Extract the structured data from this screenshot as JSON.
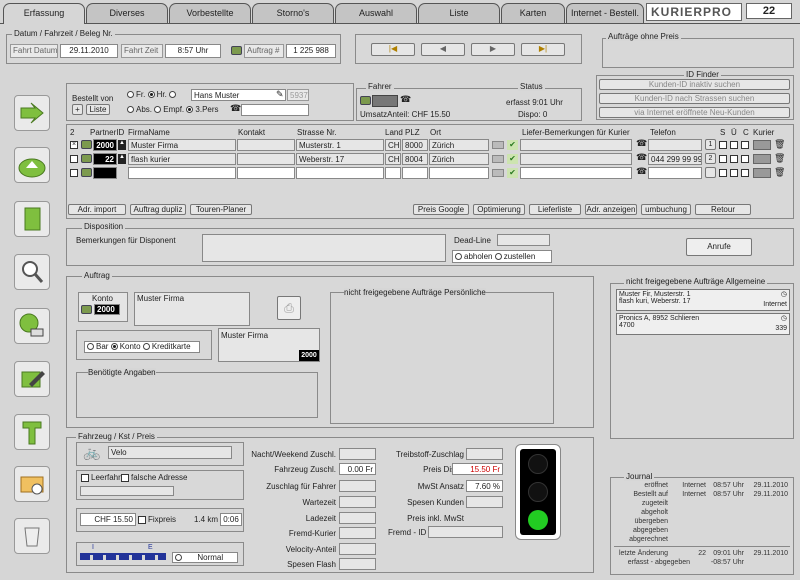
{
  "tabs": [
    "Erfassung",
    "Diverses",
    "Vorbestellte",
    "Storno's",
    "Auswahl",
    "Liste",
    "Karten",
    "Internet - Bestell."
  ],
  "logo": "KURIERPRO",
  "counter": "22",
  "datum": {
    "title": "Datum / Fahrzeit / Beleg Nr.",
    "date_label": "Fahrt Datum",
    "date": "29.11.2010",
    "time_label": "Fahrt Zeit",
    "time": "8:57 Uhr",
    "auftrag_label": "Auftrag #",
    "auftrag": "1 225 988"
  },
  "nav": [
    "|◀",
    "◀",
    "▶",
    "▶|"
  ],
  "ohne_preis": "Aufträge ohne Preis",
  "bestellt": {
    "title": "Bestellt von",
    "plus": "+",
    "liste": "Liste",
    "opt1": [
      "Fr.",
      "Hr.",
      ""
    ],
    "name": "Hans Muster",
    "code": "5937",
    "opt2": [
      "Abs.",
      "Empf.",
      "3.Pers"
    ]
  },
  "fahrer": {
    "title": "Fahrer",
    "anteil": "UmsatzAnteil: CHF 15.50"
  },
  "status": {
    "title": "Status",
    "erfasst": "erfasst 9:01 Uhr",
    "dispo": "Dispo: 0"
  },
  "finder": {
    "title": "ID Finder",
    "b1": "Kunden-ID inaktiv suchen",
    "b2": "Kunden-ID nach Strassen suchen",
    "b3": "via Internet eröffnete Neu-Kunden"
  },
  "table": {
    "headers": [
      "2",
      "PartnerID",
      "FirmaName",
      "Kontakt",
      "Strasse Nr.",
      "Land",
      "PLZ",
      "Ort",
      "Liefer-Bemerkungen für Kurier",
      "Telefon",
      "S",
      "Ü",
      "C",
      "Kurier"
    ],
    "rows": [
      {
        "id": "2000",
        "firma": "Muster Firma",
        "kontakt": "",
        "strasse": "Musterstr. 1",
        "land": "CH",
        "plz": "8000",
        "ort": "Zürich",
        "tel": "",
        "num": "1"
      },
      {
        "id": "22",
        "firma": "flash kurier",
        "kontakt": "",
        "strasse": "Weberstr. 17",
        "land": "CH",
        "plz": "8004",
        "ort": "Zürich",
        "tel": "044 299 99 99",
        "num": "2"
      },
      {
        "id": "",
        "firma": "",
        "kontakt": "",
        "strasse": "",
        "land": "",
        "plz": "",
        "ort": "",
        "tel": "",
        "num": ""
      }
    ]
  },
  "actions": [
    "Adr. import",
    "Auftrag dupliz",
    "Touren-Planer",
    "Preis Google",
    "Optimierung",
    "Lieferliste",
    "Adr. anzeigen",
    "umbuchung",
    "Retour"
  ],
  "dispo": {
    "title": "Disposition",
    "bem": "Bemerkungen für Disponent",
    "deadline": "Dead-Line",
    "abholen": "abholen",
    "zustellen": "zustellen",
    "anrufe": "Anrufe"
  },
  "auftrag": {
    "title": "Auftrag",
    "konto": "Konto",
    "konto_nr": "2000",
    "firma": "Muster Firma",
    "pay": [
      "Bar",
      "Konto",
      "Kreditkarte"
    ],
    "firma2": "Muster Firma",
    "nr2": "2000",
    "angaben": "Benötigte Angaben",
    "persoenlich": "nicht freigegebene Aufträge Persönliche"
  },
  "allgemein": {
    "title": "nicht freigegebene Aufträge Allgemeine",
    "items": [
      {
        "l1": "Muster Fir, Musterstr. 1",
        "l2": "flash kuri, Weberstr. 17",
        "r": "Internet"
      },
      {
        "l1": "Pronics A, 8952 Schlieren",
        "l2": "4700",
        "r": "339"
      }
    ]
  },
  "fahrzeug": {
    "title": "Fahrzeug / Kst / Preis",
    "type": "Velo",
    "leerfahrt": "Leerfahrt",
    "falsch": "falsche Adresse",
    "chf": "CHF 15.50",
    "fixpreis": "Fixpreis",
    "km": "1.4 km",
    "dauer": "0:06",
    "mode": "Normal",
    "meter_i": "I",
    "meter_e": "E"
  },
  "zuschlag": {
    "l": [
      "Nacht/Weekend Zuschl.",
      "Fahrzeug Zuschl.",
      "Zuschlag für Fahrer",
      "Wartezeit",
      "Ladezeit",
      "Fremd-Kurier",
      "Velocity-Anteil",
      "Spesen  Flash"
    ],
    "v": [
      "",
      "0.00 Fr",
      "",
      "",
      "",
      "",
      "",
      ""
    ],
    "r": [
      "Treibstoff-Zuschlag",
      "Preis Dispo",
      "MwSt Ansatz",
      "Spesen Kunden",
      "Preis inkl. MwSt"
    ],
    "rv": [
      "",
      "15.50 Fr",
      "7.60 %",
      "",
      ""
    ],
    "fremd": "Fremd - ID"
  },
  "journal": {
    "title": "Journal",
    "rows": [
      [
        "eröffnet",
        "Internet",
        "08:57 Uhr",
        "29.11.2010"
      ],
      [
        "Bestellt auf",
        "Internet",
        "08:57 Uhr",
        "29.11.2010"
      ],
      [
        "zugeteilt",
        "",
        "",
        ""
      ],
      [
        "abgeholt",
        "",
        "",
        ""
      ],
      [
        "übergeben",
        "",
        "",
        ""
      ],
      [
        "abgegeben",
        "",
        "",
        ""
      ],
      [
        "abgerechnet",
        "",
        "",
        ""
      ]
    ],
    "last": [
      "letzte Änderung",
      "22",
      "09:01 Uhr",
      "29.11.2010"
    ],
    "exp": [
      "erfasst - abgegeben",
      "",
      "-08:57 Uhr",
      ""
    ]
  },
  "colors": {
    "active_light": "#22cc22",
    "price_red": "#cc0000"
  }
}
